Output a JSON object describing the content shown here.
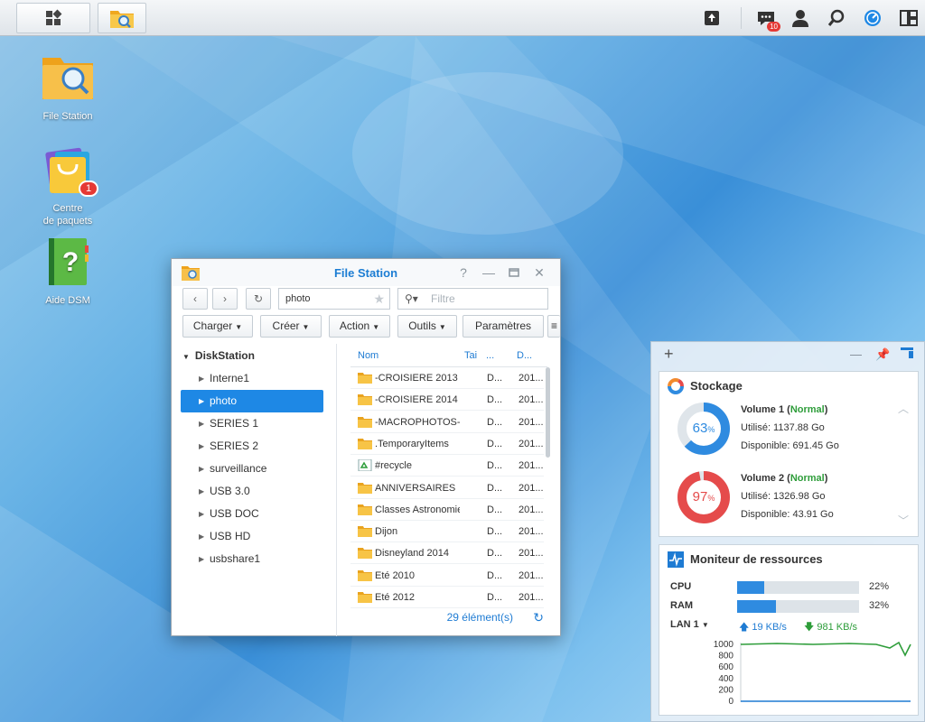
{
  "taskbar": {
    "notification_count": "10"
  },
  "desktop": {
    "icons": [
      {
        "label": "File Station"
      },
      {
        "label_line1": "Centre",
        "label_line2": "de paquets",
        "badge": "1"
      },
      {
        "label": "Aide DSM"
      }
    ]
  },
  "file_station": {
    "title": "File Station",
    "path": "photo",
    "filter_placeholder": "Filtre",
    "toolbar": {
      "upload": "Charger",
      "create": "Créer",
      "action": "Action",
      "tools": "Outils",
      "settings": "Paramètres"
    },
    "tree": {
      "root": "DiskStation",
      "items": [
        "Interne1",
        "photo",
        "SERIES 1",
        "SERIES 2",
        "surveillance",
        "USB 3.0",
        "USB DOC",
        "USB HD",
        "usbshare1"
      ],
      "selected": "photo"
    },
    "columns": [
      "Nom",
      "Tai",
      "...",
      "D..."
    ],
    "rows": [
      {
        "name": "-CROISIERE 2013",
        "c2": "D...",
        "c3": "201..."
      },
      {
        "name": "-CROISIERE 2014",
        "c2": "D...",
        "c3": "201..."
      },
      {
        "name": "-MACROPHOTOS-",
        "c2": "D...",
        "c3": "201..."
      },
      {
        "name": ".TemporaryItems",
        "c2": "D...",
        "c3": "201..."
      },
      {
        "name": "#recycle",
        "c2": "D...",
        "c3": "201..."
      },
      {
        "name": "ANNIVERSAIRES",
        "c2": "D...",
        "c3": "201..."
      },
      {
        "name": "Classes Astronomie",
        "c2": "D...",
        "c3": "201..."
      },
      {
        "name": "Dijon",
        "c2": "D...",
        "c3": "201..."
      },
      {
        "name": "Disneyland 2014",
        "c2": "D...",
        "c3": "201..."
      },
      {
        "name": "Eté 2010",
        "c2": "D...",
        "c3": "201..."
      },
      {
        "name": "Eté 2012",
        "c2": "D...",
        "c3": "201..."
      }
    ],
    "item_count": "29 élément(s)"
  },
  "widgets": {
    "storage": {
      "title": "Stockage",
      "volumes": [
        {
          "name": "Volume 1",
          "status": "Normal",
          "percent": 63,
          "percent_label": "63",
          "used": "Utilisé: 1137.88 Go",
          "available": "Disponible: 691.45 Go",
          "color": "#2f8be0"
        },
        {
          "name": "Volume 2",
          "status": "Normal",
          "percent": 97,
          "percent_label": "97",
          "used": "Utilisé: 1326.98 Go",
          "available": "Disponible: 43.91 Go",
          "color": "#e54b4b"
        }
      ]
    },
    "monitor": {
      "title": "Moniteur de ressources",
      "cpu_label": "CPU",
      "cpu_percent": 22,
      "cpu_text": "22%",
      "ram_label": "RAM",
      "ram_percent": 32,
      "ram_text": "32%",
      "lan_label": "LAN 1",
      "lan_up": "19 KB/s",
      "lan_down": "981 KB/s",
      "graph_ticks": [
        "1000",
        "800",
        "600",
        "400",
        "200",
        "0"
      ]
    }
  },
  "colors": {
    "accent": "#1e88e5",
    "ok": "#2e9d3a",
    "danger": "#e54b4b",
    "folder": "#f5b731"
  }
}
